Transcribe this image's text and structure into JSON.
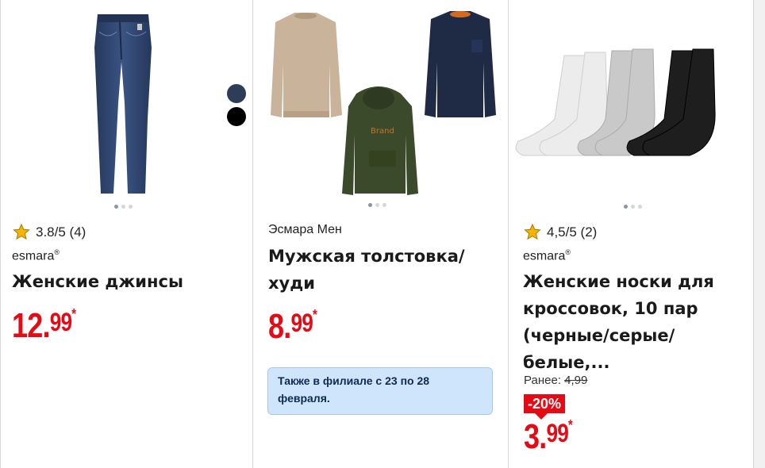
{
  "cards": [
    {
      "image_icon": "jeans-product-image",
      "rating": "3.8/5 (4)",
      "brand": "esmara",
      "brand_mark": "®",
      "title": "Женские джинсы",
      "price": {
        "main": "12.",
        "cents": "99",
        "asterisk": "*"
      }
    },
    {
      "image_icon": "sweatshirt-hoodie-product-image",
      "swatches": [
        "#2e3d57",
        "#000000"
      ],
      "brand": "Эсмара Мен",
      "title_line1": "Мужская толстовка/",
      "title_line2": "худи",
      "price": {
        "main": "8.",
        "cents": "99",
        "asterisk": "*"
      },
      "info_line1": "Также в филиале с 23 по 28",
      "info_line2": "февраля."
    },
    {
      "image_icon": "socks-product-image",
      "rating": "4,5/5 (2)",
      "brand": "esmara",
      "brand_mark": "®",
      "title_line1": "Женские носки для",
      "title_line2": "кроссовок, 10 пар",
      "title_line3": "(черные/серые/белые,...",
      "old_price_label": "Ранее:",
      "old_price": "4,99",
      "discount": "-20%",
      "price": {
        "main": "3.",
        "cents": "99",
        "asterisk": "*"
      }
    }
  ],
  "colors": {
    "price_red": "#e60a14",
    "info_bg": "#cfe5fb",
    "star": "#f5b400"
  }
}
